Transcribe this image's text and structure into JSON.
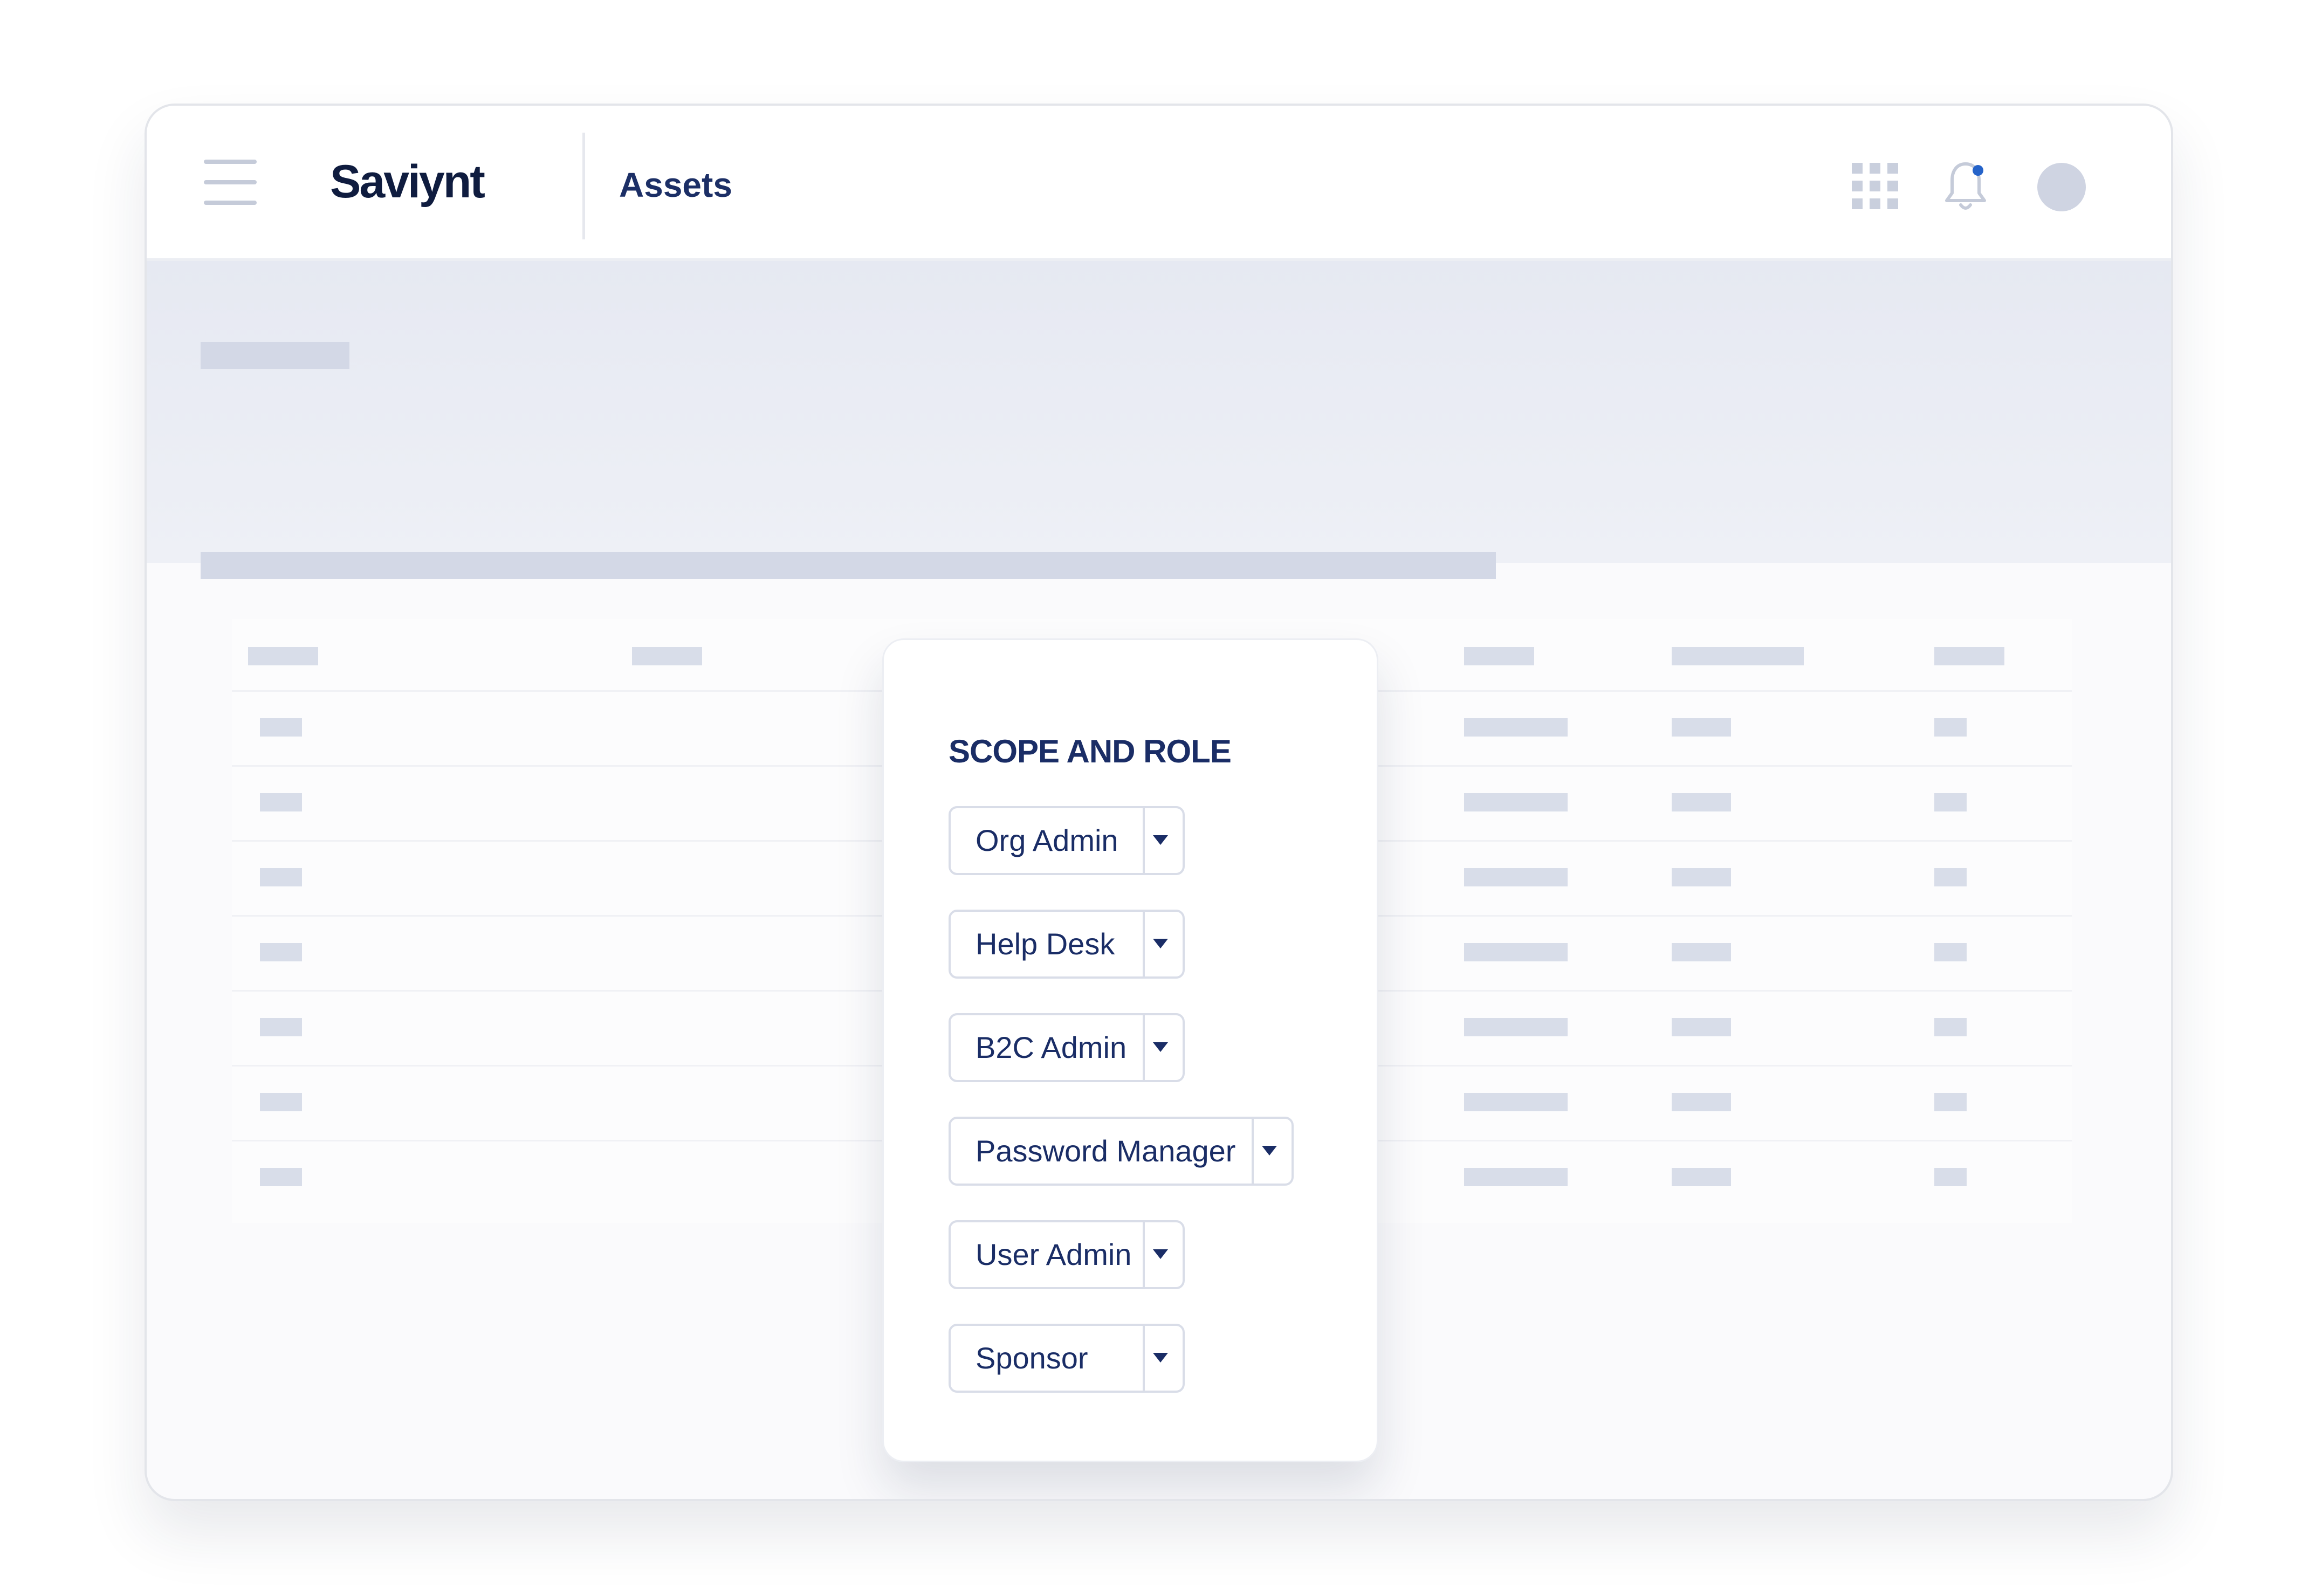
{
  "header": {
    "brand": "Saviynt",
    "title": "Assets",
    "icons": [
      "menu-icon",
      "apps-grid-icon",
      "bell-icon",
      "avatar"
    ]
  },
  "colors": {
    "navy": "#1a2d66",
    "brand": "#0f1c3f",
    "notification_dot": "#2563c9",
    "skeleton": "#d3d8e6"
  },
  "scope_role": {
    "title": "SCOPE AND ROLE",
    "dropdowns": [
      {
        "label": "Org Admin"
      },
      {
        "label": "Help Desk"
      },
      {
        "label": "B2C Admin"
      },
      {
        "label": "Password Manager"
      },
      {
        "label": "User Admin"
      },
      {
        "label": "Sponsor"
      }
    ]
  }
}
